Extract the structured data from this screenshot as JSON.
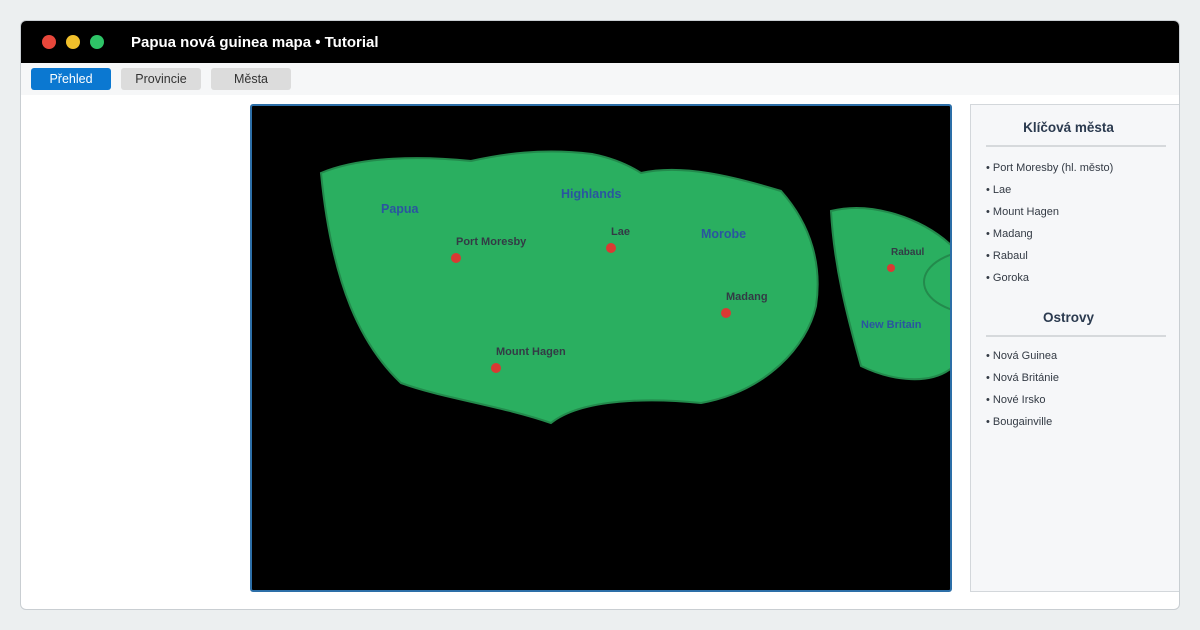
{
  "window": {
    "title": "Papua nová guinea mapa • Tutorial"
  },
  "tabs": [
    {
      "label": "Přehled",
      "active": true
    },
    {
      "label": "Provincie",
      "active": false
    },
    {
      "label": "Města",
      "active": false
    }
  ],
  "map": {
    "regions": [
      "Papua",
      "Highlands",
      "Morobe",
      "New Britain"
    ],
    "cities": [
      "Port Moresby",
      "Lae",
      "Madang",
      "Mount Hagen",
      "Rabaul"
    ],
    "colors": {
      "background": "#000000",
      "land": "#2aaf60",
      "land_stroke": "#238a4c",
      "city_marker": "#d93a33",
      "region_text": "#2a55a0"
    }
  },
  "sidebar": {
    "cities_heading": "Klíčová města",
    "cities": [
      "Port Moresby (hl. město)",
      "Lae",
      "Mount Hagen",
      "Madang",
      "Rabaul",
      "Goroka"
    ],
    "islands_heading": "Ostrovy",
    "islands": [
      "Nová Guinea",
      "Nová Británie",
      "Nové Irsko",
      "Bougainville"
    ]
  }
}
